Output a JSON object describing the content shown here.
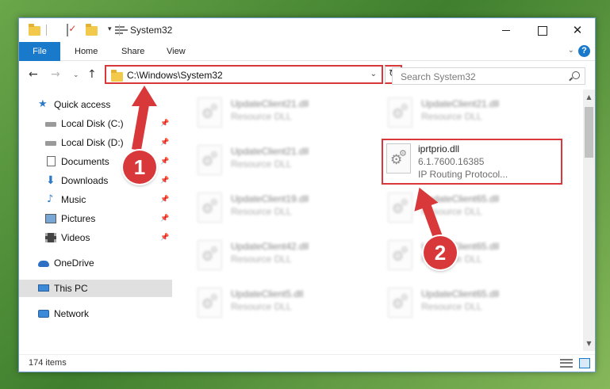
{
  "window": {
    "title": "System32",
    "quick_access_dropdown": "▾",
    "controls": {
      "minimize": "",
      "maximize": "",
      "close": "✕"
    }
  },
  "ribbon": {
    "tabs": [
      {
        "label": "File"
      },
      {
        "label": "Home"
      },
      {
        "label": "Share"
      },
      {
        "label": "View"
      }
    ],
    "expand_chevron": "⌄",
    "help": "?"
  },
  "nav": {
    "back": "←",
    "forward": "→",
    "recent": "⌄",
    "up": "↑",
    "address": "C:\\Windows\\System32",
    "address_dropdown": "⌄",
    "refresh": "↻",
    "search_placeholder": "Search System32"
  },
  "sidebar": {
    "items": [
      {
        "label": "Quick access",
        "icon": "star-icon"
      },
      {
        "label": "Local Disk (C:)",
        "icon": "drive-icon",
        "pin": "📌"
      },
      {
        "label": "Local Disk (D:)",
        "icon": "drive-icon",
        "pin": "📌"
      },
      {
        "label": "Documents",
        "icon": "documents-icon",
        "pin": "📌"
      },
      {
        "label": "Downloads",
        "icon": "download-icon",
        "pin": "📌"
      },
      {
        "label": "Music",
        "icon": "music-icon",
        "pin": "📌"
      },
      {
        "label": "Pictures",
        "icon": "pictures-icon",
        "pin": "📌"
      },
      {
        "label": "Videos",
        "icon": "videos-icon",
        "pin": "📌"
      },
      {
        "label": "OneDrive",
        "icon": "cloud-icon"
      },
      {
        "label": "This PC",
        "icon": "computer-icon"
      },
      {
        "label": "Network",
        "icon": "network-icon"
      }
    ],
    "star_glyph": "★",
    "download_glyph": "⬇",
    "music_glyph": "♪"
  },
  "files": {
    "gear_glyph": "⚙",
    "items": [
      {
        "name": "UpdateClient21.dll",
        "type": "Resource DLL"
      },
      {
        "name": "UpdateClient21.dll",
        "type": "Resource DLL"
      },
      {
        "name": "UpdateClient21.dll",
        "type": "Resource DLL"
      },
      {
        "name": "iprtprio.dll",
        "version": "6.1.7600.16385",
        "description": "IP Routing Protocol..."
      },
      {
        "name": "UpdateClient19.dll",
        "type": "Resource DLL"
      },
      {
        "name": "UpdateClient65.dll",
        "type": "Resource DLL"
      },
      {
        "name": "UpdateClient42.dll",
        "type": "Resource DLL"
      },
      {
        "name": "UpdateClient65.dll",
        "type": "Resource DLL"
      },
      {
        "name": "UpdateClient5.dll",
        "type": "Resource DLL"
      },
      {
        "name": "UpdateClient65.dll",
        "type": "Resource DLL"
      }
    ]
  },
  "scrollbar": {
    "up": "▲",
    "down": "▼"
  },
  "status": {
    "item_count": "174 items"
  },
  "callouts": {
    "step1": "1",
    "step2": "2"
  },
  "colors": {
    "accent": "#1979ca",
    "highlight": "#d9383a"
  }
}
